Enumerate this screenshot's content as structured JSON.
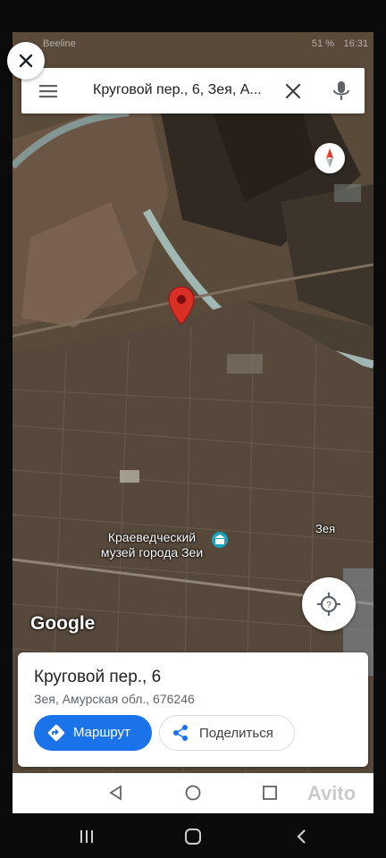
{
  "status_bar": {
    "carrier": "Beeline",
    "battery": "51 %",
    "time": "16:31"
  },
  "search": {
    "query": "Круговой пер., 6, Зея, А..."
  },
  "map": {
    "labels": {
      "museum": "Краеведческий музей города Зеи",
      "city": "Зея"
    },
    "logo": "Google"
  },
  "place": {
    "title": "Круговой пер., 6",
    "address": "Зея, Амурская обл., 676246"
  },
  "actions": {
    "route_label": "Маршрут",
    "share_label": "Поделиться"
  },
  "watermark": "Avito",
  "colors": {
    "accent": "#1a73e8",
    "pin": "#d93025",
    "museum_icon": "#1aa3b8"
  },
  "icons": {
    "close": "close-icon",
    "menu": "menu-icon",
    "clear": "clear-icon",
    "mic": "mic-icon",
    "compass": "compass-icon",
    "pin": "map-pin-icon",
    "location": "my-location-icon",
    "route": "directions-icon",
    "share": "share-icon"
  }
}
